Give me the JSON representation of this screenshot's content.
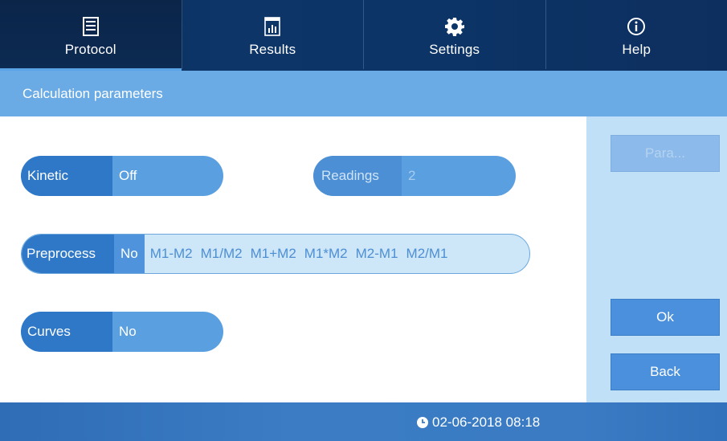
{
  "nav": {
    "tabs": [
      {
        "label": "Protocol",
        "icon": "document-icon",
        "active": true
      },
      {
        "label": "Results",
        "icon": "bar-chart-icon",
        "active": false
      },
      {
        "label": "Settings",
        "icon": "gear-icon",
        "active": false
      },
      {
        "label": "Help",
        "icon": "info-icon",
        "active": false
      }
    ]
  },
  "header": {
    "title": "Calculation parameters"
  },
  "form": {
    "kinetic": {
      "label": "Kinetic",
      "value": "Off"
    },
    "readings": {
      "label": "Readings",
      "value": "2"
    },
    "preprocess": {
      "label": "Preprocess",
      "options": [
        "No",
        "M1-M2",
        "M1/M2",
        "M1+M2",
        "M1*M2",
        "M2-M1",
        "M2/M1"
      ],
      "selected": "No"
    },
    "curves": {
      "label": "Curves",
      "value": "No"
    }
  },
  "side": {
    "para_label": "Para...",
    "ok_label": "Ok",
    "back_label": "Back"
  },
  "footer": {
    "datetime": "02-06-2018 08:18",
    "icon": "clock-icon"
  },
  "colors": {
    "nav_bg": "#0c3466",
    "header_bg": "#6aabe6",
    "side_bg": "#bfe0f7",
    "accent": "#4a90dc"
  }
}
